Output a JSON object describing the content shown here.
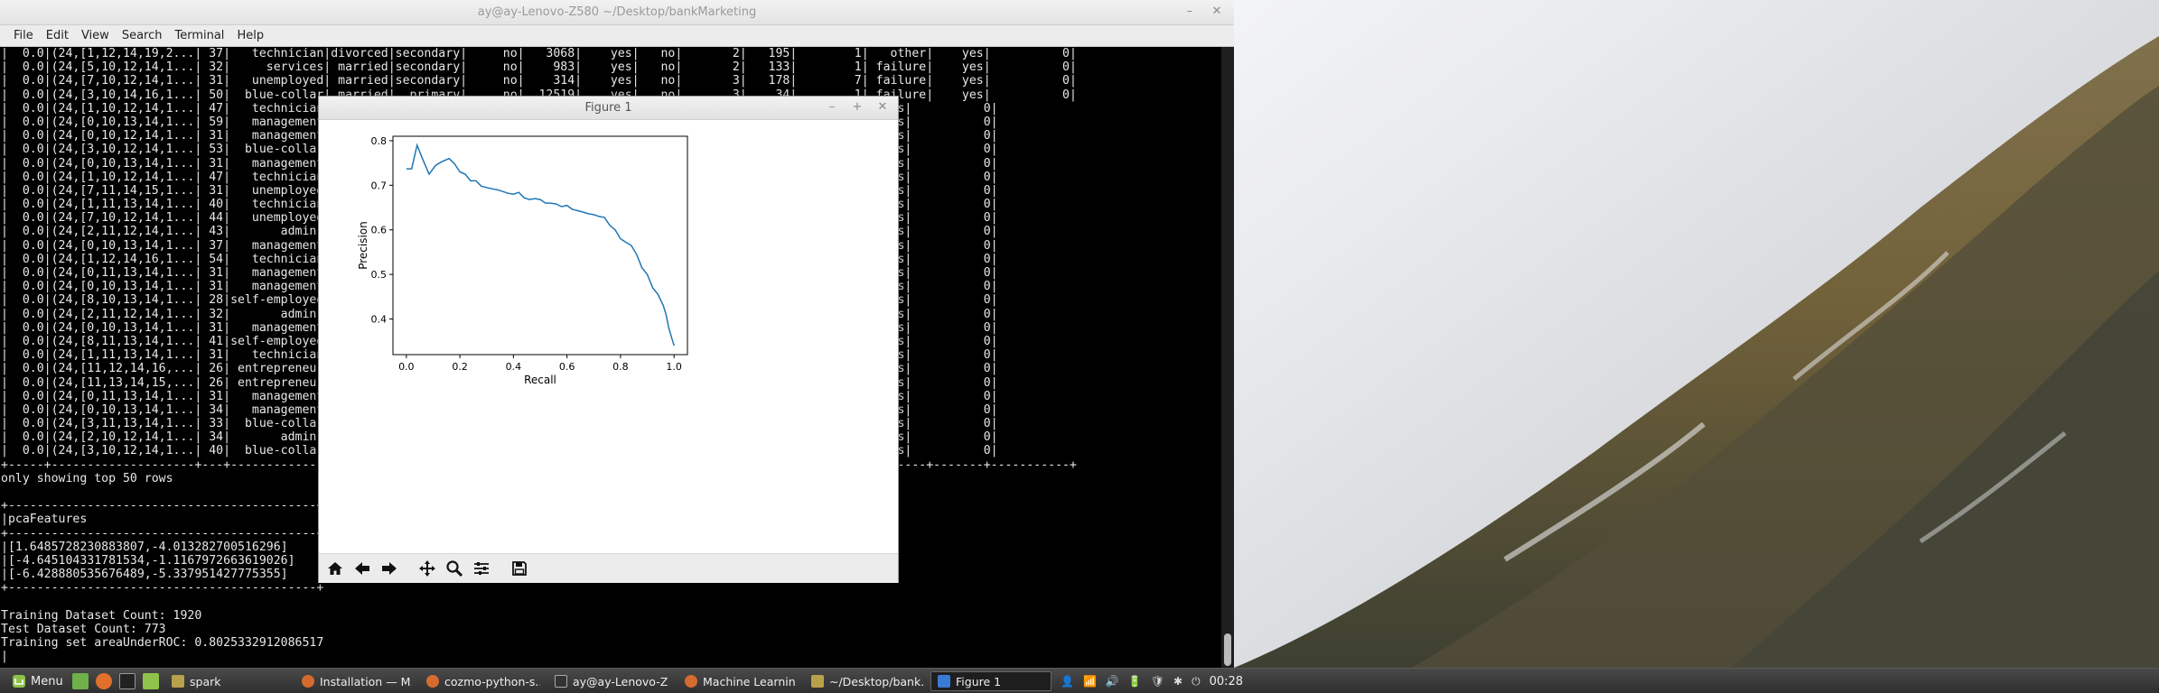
{
  "terminal": {
    "title": "ay@ay-Lenovo-Z580 ~/Desktop/bankMarketing",
    "menu": [
      "File",
      "Edit",
      "View",
      "Search",
      "Terminal",
      "Help"
    ],
    "lines": [
      "|  0.0|(24,[1,12,14,19,2...| 37|   technician|divorced|secondary|     no|   3068|    yes|   no|       2|   195|        1|   other|    yes|          0|",
      "|  0.0|(24,[5,10,12,14,1...| 32|     services| married|secondary|     no|    983|    yes|   no|       2|   133|        1| failure|    yes|          0|",
      "|  0.0|(24,[7,10,12,14,1...| 31|   unemployed| married|secondary|     no|    314|    yes|   no|       3|   178|        7| failure|    yes|          0|",
      "|  0.0|(24,[3,10,14,16,1...| 50|  blue-collar| married|  primary|     no|  12519|    yes|   no|       3|    34|        1| failure|    yes|          0|",
      "|  0.0|(24,[1,10,12,14,1...| 47|   technician|                                                                   other|    yes|          0|",
      "|  0.0|(24,[0,10,13,14,1...| 59|   management|                                                                   other|    yes|          0|",
      "|  0.0|(24,[0,10,12,14,1...| 31|   management|                                                                   other|    yes|          0|",
      "|  0.0|(24,[3,10,12,14,1...| 53|  blue-collar|                                                                   other|    yes|          0|",
      "|  0.0|(24,[0,10,13,14,1...| 31|   management|                                                                   other|    yes|          0|",
      "|  0.0|(24,[1,10,12,14,1...| 47|   technician|                                                                   other|    yes|          0|",
      "|  0.0|(24,[7,11,14,15,1...| 31|   unemployed|                                                                   other|    yes|          0|",
      "|  0.0|(24,[1,11,13,14,1...| 40|   technician|                                                                 failure|    yes|          0|",
      "|  0.0|(24,[7,10,12,14,1...| 44|   unemployed|                                                                 failure|    yes|          0|",
      "|  0.0|(24,[2,11,12,14,1...| 43|       admin.|                                                                 failure|    yes|          0|",
      "|  0.0|(24,[0,10,13,14,1...| 37|   management|                                                                 failure|    yes|          0|",
      "|  0.0|(24,[1,12,14,16,1...| 54|   technician|                                                                 failure|    yes|          0|",
      "|  0.0|(24,[0,11,13,14,1...| 31|   management|                                                                   other|    yes|          0|",
      "|  0.0|(24,[0,10,13,14,1...| 31|   management|                                                                   other|    yes|          0|",
      "|  0.0|(24,[8,10,13,14,1...| 28|self-employed|                                                                 failure|    yes|          0|",
      "|  0.0|(24,[2,11,12,14,1...| 32|       admin.|                                                                 failure|    yes|          0|",
      "|  0.0|(24,[0,10,13,14,1...| 31|   management|                                                                 failure|    yes|          0|",
      "|  0.0|(24,[8,11,13,14,1...| 41|self-employed|                                                                 failure|    yes|          0|",
      "|  0.0|(24,[1,11,13,14,1...| 31|   technician|                                                                 failure|    yes|          0|",
      "|  0.0|(24,[11,12,14,16,...| 26| entrepreneur|                                                                 failure|    yes|          0|",
      "|  0.0|(24,[11,13,14,15,...| 26| entrepreneur|                                                                 failure|    yes|          0|",
      "|  0.0|(24,[0,11,13,14,1...| 31|   management|                                                                 success|    yes|          0|",
      "|  0.0|(24,[0,10,13,14,1...| 34|   management|                                                                 success|    yes|          0|",
      "|  0.0|(24,[3,11,13,14,1...| 33|  blue-collar|                                                                 success|    yes|          0|",
      "|  0.0|(24,[2,10,12,14,1...| 34|       admin.|                                                                 success|    yes|          0|",
      "|  0.0|(24,[3,10,12,14,1...| 40|  blue-collar|                                                                 success|    yes|          0|",
      "+-----+--------------------+---+-------------+--------+---------+-------+-------+-------+-----+--------+------+---------+--------+-------+-----------+",
      "only showing top 50 rows",
      "",
      "+-------------------------------------------+",
      "|pcaFeatures                                |",
      "+-------------------------------------------+",
      "|[1.6485728230883807,-4.013282700516296]    |",
      "|[-4.645104331781534,-1.1167972663619026]   |",
      "|[-6.428880535676489,-5.337951427775355]    |",
      "+-------------------------------------------+",
      "",
      "Training Dataset Count: 1920",
      "Test Dataset Count: 773",
      "Training set areaUnderROC: 0.8025332912086517",
      "|"
    ]
  },
  "figure": {
    "title": "Figure 1",
    "toolbar": [
      "home-icon",
      "back-icon",
      "forward-icon",
      "pan-icon",
      "zoom-icon",
      "configure-subplots-icon",
      "save-icon"
    ]
  },
  "chart_data": {
    "type": "line",
    "title": "",
    "xlabel": "Recall",
    "ylabel": "Precision",
    "xlim": [
      -0.05,
      1.05
    ],
    "ylim": [
      0.32,
      0.81
    ],
    "xticks": [
      "0.0",
      "0.2",
      "0.4",
      "0.6",
      "0.8",
      "1.0"
    ],
    "yticks": [
      "0.4",
      "0.5",
      "0.6",
      "0.7",
      "0.8"
    ],
    "grid": false,
    "color": "#1f77b4",
    "series": [
      {
        "x": [
          0.0,
          0.02,
          0.04,
          0.06,
          0.085,
          0.11,
          0.13,
          0.16,
          0.18,
          0.2,
          0.22,
          0.24,
          0.26,
          0.28,
          0.3,
          0.32,
          0.34,
          0.36,
          0.38,
          0.4,
          0.42,
          0.44,
          0.46,
          0.48,
          0.5,
          0.52,
          0.54,
          0.56,
          0.58,
          0.6,
          0.62,
          0.64,
          0.66,
          0.68,
          0.7,
          0.72,
          0.74,
          0.76,
          0.78,
          0.8,
          0.82,
          0.84,
          0.86,
          0.88,
          0.9,
          0.92,
          0.94,
          0.96,
          0.97,
          0.98,
          0.99,
          1.0
        ],
        "y": [
          0.737,
          0.737,
          0.79,
          0.76,
          0.725,
          0.745,
          0.752,
          0.76,
          0.748,
          0.73,
          0.725,
          0.71,
          0.71,
          0.698,
          0.695,
          0.692,
          0.69,
          0.686,
          0.682,
          0.68,
          0.684,
          0.672,
          0.668,
          0.67,
          0.668,
          0.66,
          0.66,
          0.658,
          0.652,
          0.655,
          0.646,
          0.643,
          0.64,
          0.636,
          0.634,
          0.63,
          0.628,
          0.61,
          0.6,
          0.58,
          0.572,
          0.565,
          0.545,
          0.515,
          0.5,
          0.47,
          0.455,
          0.43,
          0.41,
          0.38,
          0.36,
          0.34
        ]
      }
    ]
  },
  "taskbar": {
    "menu_label": "Menu",
    "tasks": [
      {
        "label": "spark",
        "icon": "folder-icon",
        "color": "#b9a04a"
      },
      {
        "label": "Installation — M...",
        "icon": "browser-icon",
        "color": "#d66b2f"
      },
      {
        "label": "cozmo-python-s...",
        "icon": "browser-icon",
        "color": "#d66b2f"
      },
      {
        "label": "ay@ay-Lenovo-Z...",
        "icon": "terminal-icon",
        "color": "#333333"
      },
      {
        "label": "Machine Learnin...",
        "icon": "browser-icon",
        "color": "#d66b2f"
      },
      {
        "label": "~/Desktop/bank...",
        "icon": "folder-icon",
        "color": "#b9a04a"
      },
      {
        "label": "Figure 1",
        "icon": "figure-icon",
        "color": "#3a7bd5"
      }
    ],
    "clock": "00:28"
  }
}
